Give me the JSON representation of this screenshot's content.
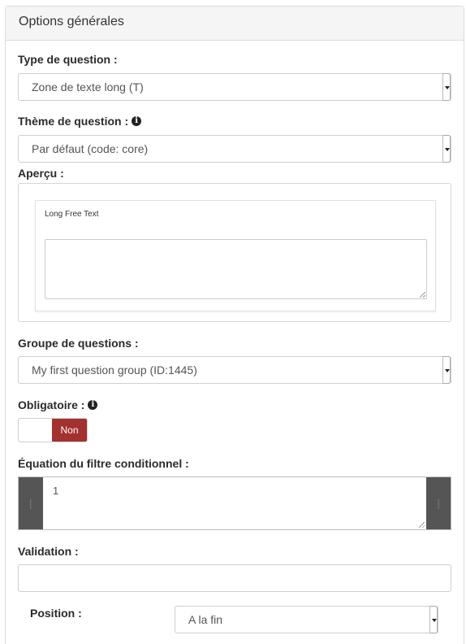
{
  "panel": {
    "title": "Options générales"
  },
  "question_type": {
    "label": "Type de question :",
    "value": "Zone de texte long (T)"
  },
  "question_theme": {
    "label": "Thème de question :",
    "value": "Par défaut (code: core)",
    "info_icon": "info-icon"
  },
  "preview": {
    "label": "Aperçu :",
    "question_text": "Long Free Text"
  },
  "question_group": {
    "label": "Groupe de questions :",
    "value": "My first question group (ID:1445)"
  },
  "mandatory": {
    "label": "Obligatoire :",
    "info_icon": "info-icon",
    "toggle_off_label": "Non",
    "toggle_color": "#a3312f"
  },
  "condition": {
    "label": "Équation du filtre conditionnel :",
    "value": "1",
    "left_bracket": "[",
    "right_bracket": "]"
  },
  "validation": {
    "label": "Validation :",
    "value": ""
  },
  "position": {
    "label": "Position :",
    "value": "A la fin"
  }
}
